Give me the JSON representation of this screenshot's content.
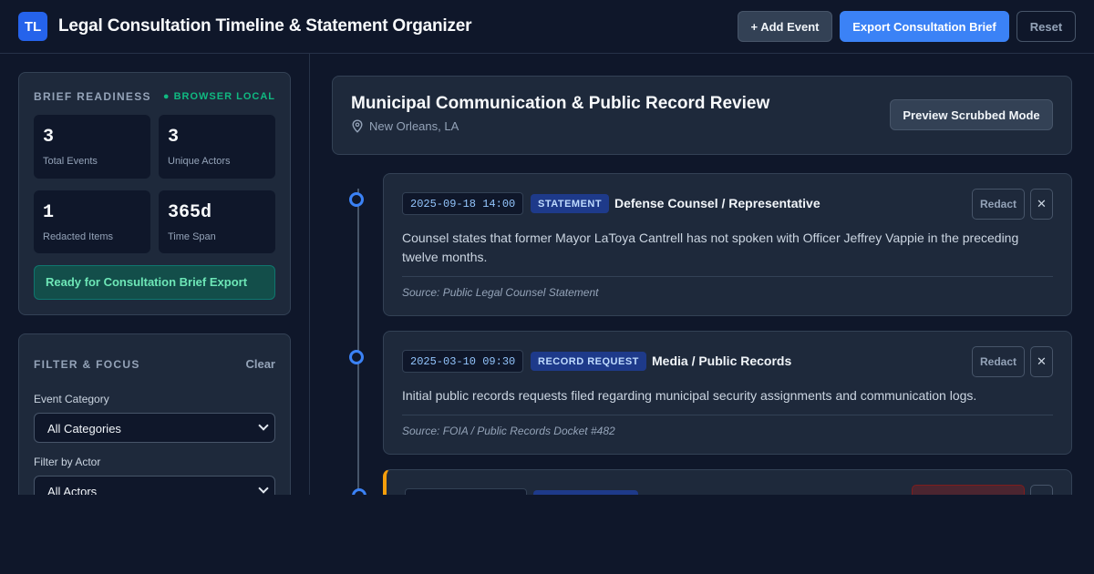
{
  "header": {
    "logo": "TL",
    "title": "Legal Consultation Timeline & Statement Organizer",
    "add_label": "+ Add Event",
    "export_label": "Export Consultation Brief",
    "reset_label": "Reset"
  },
  "readiness": {
    "heading": "BRIEF READINESS",
    "badge": "● BROWSER LOCAL",
    "stats": [
      {
        "value": "3",
        "label": "Total Events"
      },
      {
        "value": "3",
        "label": "Unique Actors"
      },
      {
        "value": "1",
        "label": "Redacted Items"
      },
      {
        "value": "365d",
        "label": "Time Span"
      }
    ],
    "status": "Ready for Consultation Brief Export"
  },
  "filter": {
    "heading": "FILTER & FOCUS",
    "clear_label": "Clear",
    "category_label": "Event Category",
    "category_value": "All Categories",
    "actor_label": "Filter by Actor",
    "actor_value": "All Actors"
  },
  "case": {
    "title": "Municipal Communication & Public Record Review",
    "location": "New Orleans, LA",
    "preview_label": "Preview Scrubbed Mode",
    "icons": {
      "location": "map-pin-icon"
    }
  },
  "events": [
    {
      "timestamp": "2025-09-18 14:00",
      "category": "STATEMENT",
      "actor": "Defense Counsel / Representative",
      "description": "Counsel states that former Mayor LaToya Cantrell has not spoken with Officer Jeffrey Vappie in the preceding twelve months.",
      "source": "Source: Public Legal Counsel Statement",
      "redact_label": "Redact",
      "close_label": "✕"
    },
    {
      "timestamp": "2025-03-10 09:30",
      "category": "RECORD REQUEST",
      "actor": "Media / Public Records",
      "description": "Initial public records requests filed regarding municipal security assignments and communication logs.",
      "source": "Source: FOIA / Public Records Docket #482",
      "redact_label": "Redact",
      "close_label": "✕"
    }
  ],
  "colors": {
    "accent": "#3b82f6",
    "ready_text": "#6ee7b7",
    "redacted_border": "#f59e0b"
  }
}
